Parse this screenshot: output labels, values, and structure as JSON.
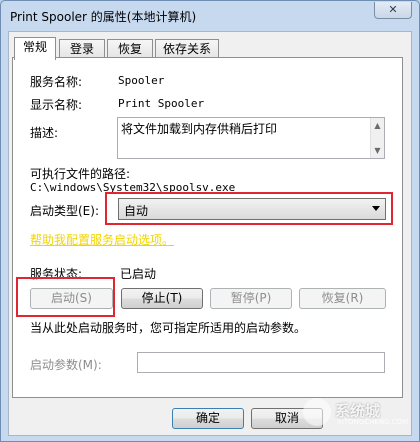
{
  "window": {
    "title": "Print Spooler 的属性(本地计算机)",
    "close_glyph": "✕"
  },
  "tabs": [
    {
      "label": "常规",
      "active": true
    },
    {
      "label": "登录",
      "active": false
    },
    {
      "label": "恢复",
      "active": false
    },
    {
      "label": "依存关系",
      "active": false
    }
  ],
  "general": {
    "service_name_label": "服务名称:",
    "service_name_value": "Spooler",
    "display_name_label": "显示名称:",
    "display_name_value": "Print Spooler",
    "description_label": "描述:",
    "description_value": "将文件加载到内存供稍后打印",
    "exe_path_label": "可执行文件的路径:",
    "exe_path_value": "C:\\windows\\System32\\spoolsv.exe",
    "startup_type_label": "启动类型(E):",
    "startup_type_value": "自动",
    "help_link": "帮助我配置服务启动选项。",
    "service_status_label": "服务状态:",
    "service_status_value": "已启动",
    "buttons": {
      "start": "启动(S)",
      "stop": "停止(T)",
      "pause": "暂停(P)",
      "resume": "恢复(R)"
    },
    "hint_text": "当从此处启动服务时，您可指定所适用的启动参数。",
    "start_params_label": "启动参数(M):",
    "start_params_value": ""
  },
  "footer": {
    "ok_label": "确定",
    "cancel_label": "取消"
  },
  "watermark": {
    "text": "系统城",
    "sub": "XITONGCHENG.COM"
  },
  "colors": {
    "highlight_box": "#e0262e",
    "link": "#f2d600"
  }
}
